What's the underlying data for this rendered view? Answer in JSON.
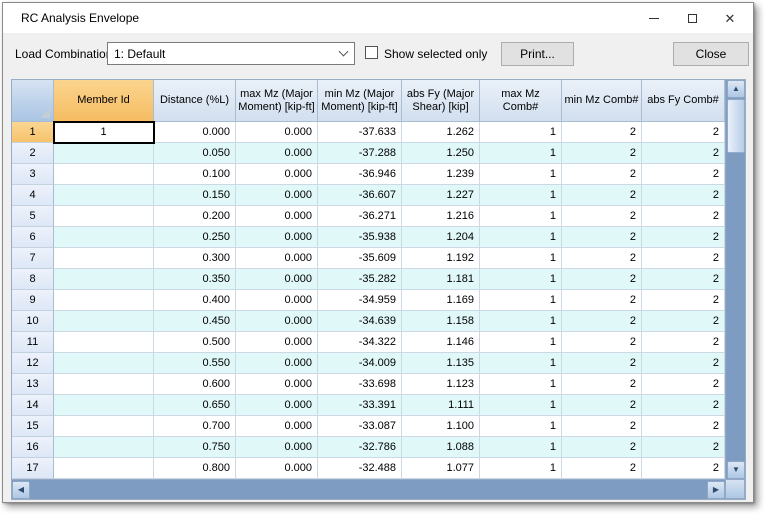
{
  "window": {
    "title": "RC Analysis Envelope"
  },
  "toolbar": {
    "load_combination_label": "Load Combination:",
    "load_combination_value": "1: Default",
    "show_selected_only_label": "Show selected only",
    "show_selected_only_checked": false,
    "print_button_label": "Print...",
    "close_button_label": "Close"
  },
  "table": {
    "columns": [
      "Member Id",
      "Distance (%L)",
      "max Mz (Major Moment) [kip-ft]",
      "min Mz (Major Moment) [kip-ft]",
      "abs Fy (Major Shear) [kip]",
      "max Mz Comb#",
      "min Mz Comb#",
      "abs Fy Comb#"
    ],
    "selected_cell": {
      "row": 1,
      "column": "Member Id",
      "value": "1"
    },
    "rows": [
      [
        "1",
        "0.000",
        "0.000",
        "-37.633",
        "1.262",
        "1",
        "2",
        "2"
      ],
      [
        "",
        "0.050",
        "0.000",
        "-37.288",
        "1.250",
        "1",
        "2",
        "2"
      ],
      [
        "",
        "0.100",
        "0.000",
        "-36.946",
        "1.239",
        "1",
        "2",
        "2"
      ],
      [
        "",
        "0.150",
        "0.000",
        "-36.607",
        "1.227",
        "1",
        "2",
        "2"
      ],
      [
        "",
        "0.200",
        "0.000",
        "-36.271",
        "1.216",
        "1",
        "2",
        "2"
      ],
      [
        "",
        "0.250",
        "0.000",
        "-35.938",
        "1.204",
        "1",
        "2",
        "2"
      ],
      [
        "",
        "0.300",
        "0.000",
        "-35.609",
        "1.192",
        "1",
        "2",
        "2"
      ],
      [
        "",
        "0.350",
        "0.000",
        "-35.282",
        "1.181",
        "1",
        "2",
        "2"
      ],
      [
        "",
        "0.400",
        "0.000",
        "-34.959",
        "1.169",
        "1",
        "2",
        "2"
      ],
      [
        "",
        "0.450",
        "0.000",
        "-34.639",
        "1.158",
        "1",
        "2",
        "2"
      ],
      [
        "",
        "0.500",
        "0.000",
        "-34.322",
        "1.146",
        "1",
        "2",
        "2"
      ],
      [
        "",
        "0.550",
        "0.000",
        "-34.009",
        "1.135",
        "1",
        "2",
        "2"
      ],
      [
        "",
        "0.600",
        "0.000",
        "-33.698",
        "1.123",
        "1",
        "2",
        "2"
      ],
      [
        "",
        "0.650",
        "0.000",
        "-33.391",
        "1.111",
        "1",
        "2",
        "2"
      ],
      [
        "",
        "0.700",
        "0.000",
        "-33.087",
        "1.100",
        "1",
        "2",
        "2"
      ],
      [
        "",
        "0.750",
        "0.000",
        "-32.786",
        "1.088",
        "1",
        "2",
        "2"
      ],
      [
        "",
        "0.800",
        "0.000",
        "-32.488",
        "1.077",
        "1",
        "2",
        "2"
      ]
    ]
  },
  "colors": {
    "header_highlight": "#f5bc62",
    "header_blue": "#d2dfef",
    "row_alt": "#e1f8f9",
    "scrollbar_track": "#7e9bc2",
    "selection_border": "#000000",
    "dialog_background": "#f0f0f0"
  }
}
